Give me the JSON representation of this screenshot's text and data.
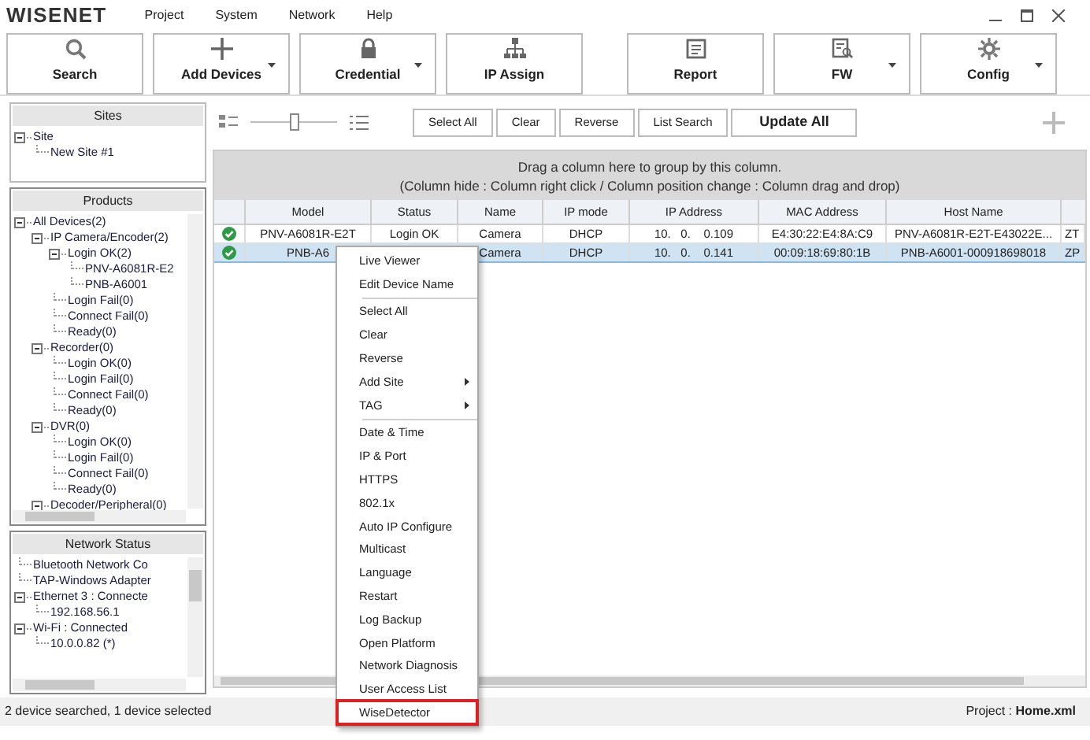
{
  "app": {
    "logo": "WISENET"
  },
  "menu": [
    "Project",
    "System",
    "Network",
    "Help"
  ],
  "toolbar": [
    {
      "label": "Search",
      "kind": "search",
      "dropdown": false
    },
    {
      "label": "Add Devices",
      "kind": "plus",
      "dropdown": true
    },
    {
      "label": "Credential",
      "kind": "lock",
      "dropdown": true
    },
    {
      "label": "IP Assign",
      "kind": "network",
      "dropdown": false
    },
    {
      "label": "Report",
      "kind": "report",
      "dropdown": false
    },
    {
      "label": "FW",
      "kind": "fw",
      "dropdown": true
    },
    {
      "label": "Config",
      "kind": "gear",
      "dropdown": true
    }
  ],
  "sites": {
    "title": "Sites",
    "tree": [
      {
        "label": "Site",
        "expanded": true,
        "children": [
          {
            "label": "New Site #1"
          }
        ]
      }
    ]
  },
  "products": {
    "title": "Products",
    "tree": [
      {
        "label": "All Devices(2)",
        "expanded": true,
        "children": [
          {
            "label": "IP Camera/Encoder(2)",
            "expanded": true,
            "children": [
              {
                "label": "Login OK(2)",
                "expanded": true,
                "children": [
                  {
                    "label": "PNV-A6081R-E2"
                  },
                  {
                    "label": "PNB-A6001"
                  }
                ]
              },
              {
                "label": "Login Fail(0)"
              },
              {
                "label": "Connect Fail(0)"
              },
              {
                "label": "Ready(0)"
              }
            ]
          },
          {
            "label": "Recorder(0)",
            "expanded": true,
            "children": [
              {
                "label": "Login OK(0)"
              },
              {
                "label": "Login Fail(0)"
              },
              {
                "label": "Connect Fail(0)"
              },
              {
                "label": "Ready(0)"
              }
            ]
          },
          {
            "label": "DVR(0)",
            "expanded": true,
            "children": [
              {
                "label": "Login OK(0)"
              },
              {
                "label": "Login Fail(0)"
              },
              {
                "label": "Connect Fail(0)"
              },
              {
                "label": "Ready(0)"
              }
            ]
          },
          {
            "label": "Decoder/Peripheral(0)",
            "expanded": true
          }
        ]
      }
    ]
  },
  "network_status": {
    "title": "Network Status",
    "tree": [
      {
        "label": "Bluetooth Network Co"
      },
      {
        "label": "TAP-Windows Adapter"
      },
      {
        "label": "Ethernet 3 : Connecte",
        "expanded": true,
        "children": [
          {
            "label": "192.168.56.1"
          }
        ]
      },
      {
        "label": "Wi-Fi : Connected",
        "expanded": true,
        "children": [
          {
            "label": "10.0.0.82 (*)"
          }
        ]
      }
    ]
  },
  "list_toolbar": {
    "zoom": {
      "level": 0.5
    },
    "buttons": [
      "Select All",
      "Clear",
      "Reverse",
      "List Search"
    ],
    "update_button": "Update All"
  },
  "group_hint": [
    "Drag a column here to group by this column.",
    "(Column hide : Column right click / Column position change : Column drag and drop)"
  ],
  "table": {
    "columns": [
      "Model",
      "Status",
      "Name",
      "IP mode",
      "IP Address",
      "MAC Address",
      "Host Name"
    ],
    "rows": [
      {
        "selected": false,
        "ok": true,
        "cells": [
          "PNV-A6081R-E2T",
          "Login OK",
          "Camera",
          "DHCP",
          "10.   0.    0.109",
          "E4:30:22:E4:8A:C9",
          "PNV-A6081R-E2T-E43022E...",
          "ZT"
        ]
      },
      {
        "selected": true,
        "ok": true,
        "cells": [
          "PNB-A6",
          "",
          "Camera",
          "DHCP",
          "10.   0.    0.141",
          "00:09:18:69:80:1B",
          "PNB-A6001-000918698018",
          "ZP"
        ]
      }
    ]
  },
  "context_menu": [
    {
      "label": "Live Viewer"
    },
    {
      "label": "Edit Device Name",
      "separator_after": true
    },
    {
      "label": "Select All"
    },
    {
      "label": "Clear"
    },
    {
      "label": "Reverse"
    },
    {
      "label": "Add Site",
      "submenu": true
    },
    {
      "label": "TAG",
      "submenu": true,
      "separator_after": true
    },
    {
      "label": "Date & Time"
    },
    {
      "label": "IP & Port"
    },
    {
      "label": "HTTPS"
    },
    {
      "label": "802.1x"
    },
    {
      "label": "Auto IP Configure"
    },
    {
      "label": "Multicast"
    },
    {
      "label": "Language"
    },
    {
      "label": "Restart"
    },
    {
      "label": "Log Backup"
    },
    {
      "label": "Open Platform"
    },
    {
      "label": "Network Diagnosis"
    },
    {
      "label": "User Access List"
    },
    {
      "label": "WiseDetector",
      "highlighted": true
    }
  ],
  "status_bar": {
    "left": "2 device searched, 1 device selected",
    "right": "Project : **Home.xml**"
  }
}
